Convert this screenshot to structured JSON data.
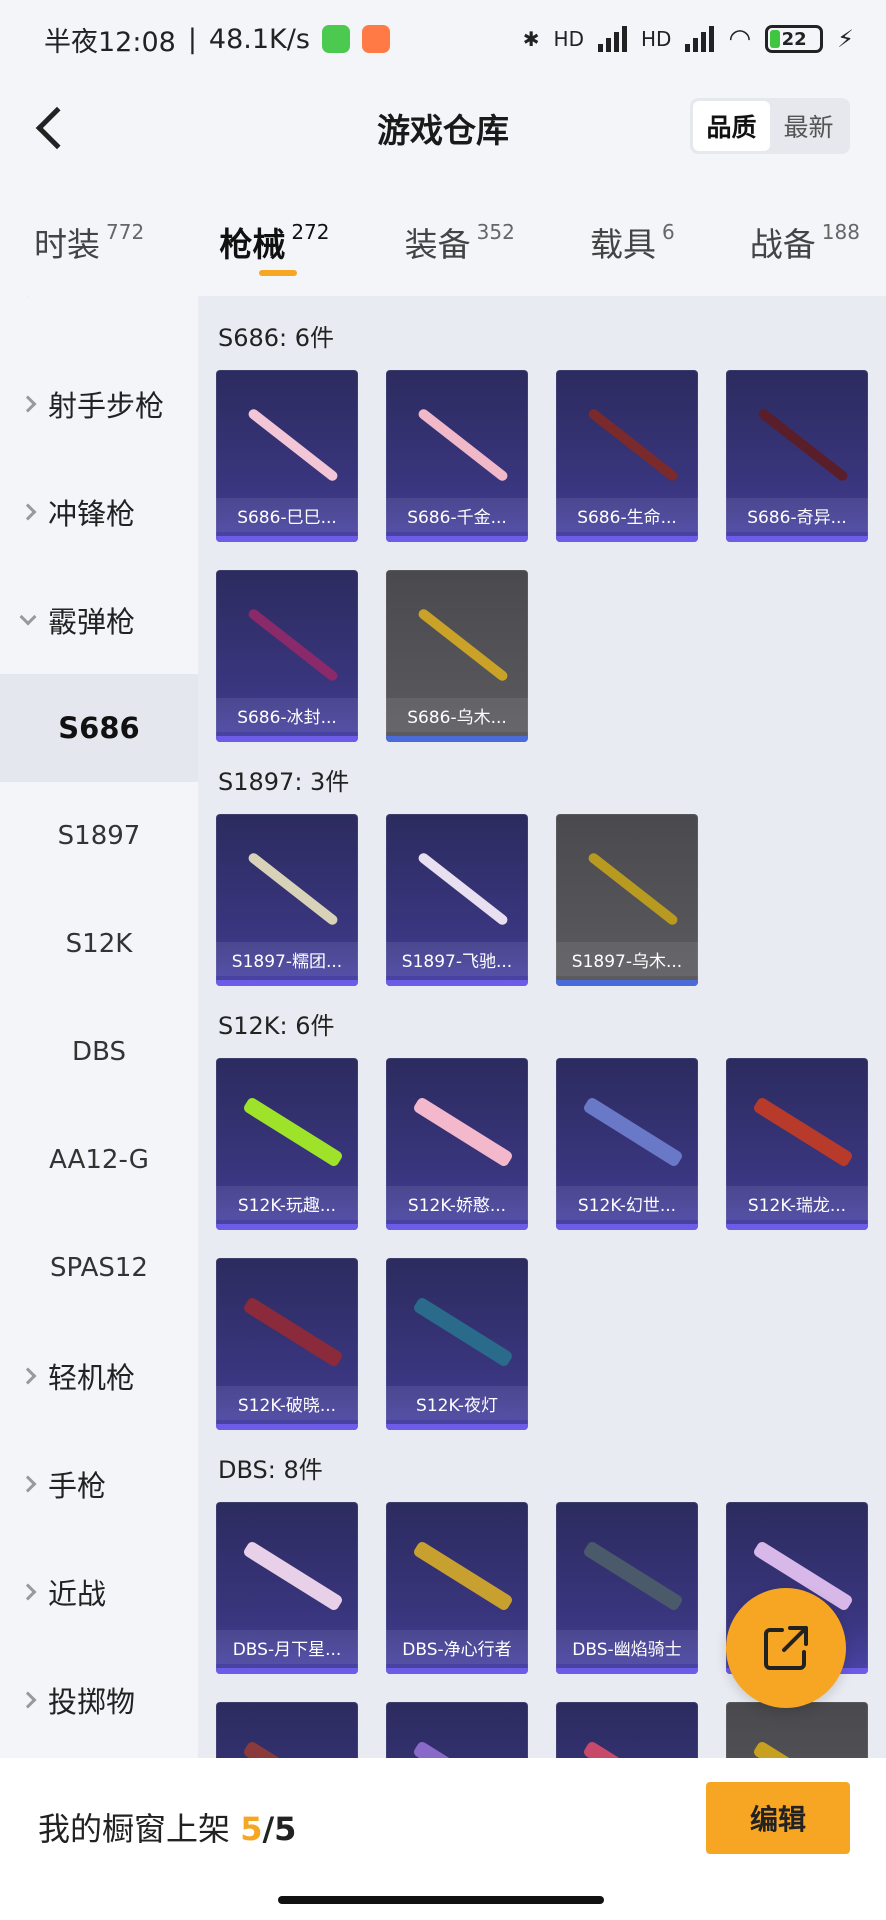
{
  "status_bar": {
    "time": "半夜12:08",
    "speed": "48.1K/s",
    "hd1": "HD",
    "hd2": "HD",
    "battery": "22"
  },
  "header": {
    "title": "游戏仓库",
    "sort_options": [
      "品质",
      "最新"
    ]
  },
  "tabs": [
    {
      "label": "时装",
      "count": "772"
    },
    {
      "label": "枪械",
      "count": "272"
    },
    {
      "label": "装备",
      "count": "352"
    },
    {
      "label": "载具",
      "count": "6"
    },
    {
      "label": "战备",
      "count": "188"
    }
  ],
  "sidebar": {
    "items": [
      {
        "label": "射手步枪"
      },
      {
        "label": "冲锋枪"
      },
      {
        "label": "霰弹枪"
      },
      {
        "label": "S686"
      },
      {
        "label": "S1897"
      },
      {
        "label": "S12K"
      },
      {
        "label": "DBS"
      },
      {
        "label": "AA12-G"
      },
      {
        "label": "SPAS12"
      },
      {
        "label": "轻机枪"
      },
      {
        "label": "手枪"
      },
      {
        "label": "近战"
      },
      {
        "label": "投掷物"
      }
    ]
  },
  "sections": [
    {
      "title": "S686: 6件",
      "items": [
        {
          "name": "S686-巳巳...",
          "gun_color": "#f2c6d6",
          "quality": "purple"
        },
        {
          "name": "S686-千金...",
          "gun_color": "#f0b8c8",
          "quality": "purple"
        },
        {
          "name": "S686-生命...",
          "gun_color": "#7a2a2a",
          "quality": "purple"
        },
        {
          "name": "S686-奇异...",
          "gun_color": "#5a1e2a",
          "quality": "purple"
        },
        {
          "name": "S686-冰封...",
          "gun_color": "#8a2a6a",
          "quality": "purple"
        },
        {
          "name": "S686-乌木...",
          "gun_color": "#c9a227",
          "quality": "grey"
        }
      ]
    },
    {
      "title": "S1897: 3件",
      "items": [
        {
          "name": "S1897-糯团...",
          "gun_color": "#d8d2b8",
          "quality": "purple"
        },
        {
          "name": "S1897-飞驰...",
          "gun_color": "#e8e0f0",
          "quality": "purple"
        },
        {
          "name": "S1897-乌木...",
          "gun_color": "#b89a20",
          "quality": "grey"
        }
      ]
    },
    {
      "title": "S12K: 6件",
      "items": [
        {
          "name": "S12K-玩趣...",
          "gun_color": "#9ee22a",
          "quality": "purple"
        },
        {
          "name": "S12K-娇憨...",
          "gun_color": "#f4b8cc",
          "quality": "purple"
        },
        {
          "name": "S12K-幻世...",
          "gun_color": "#6a78c8",
          "quality": "purple"
        },
        {
          "name": "S12K-瑞龙...",
          "gun_color": "#b83a2a",
          "quality": "purple"
        },
        {
          "name": "S12K-破晓...",
          "gun_color": "#8a2a3a",
          "quality": "purple"
        },
        {
          "name": "S12K-夜灯",
          "gun_color": "#2a6a8a",
          "quality": "purple"
        }
      ]
    },
    {
      "title": "DBS: 8件",
      "items": [
        {
          "name": "DBS-月下星...",
          "gun_color": "#e8d0e8",
          "quality": "purple"
        },
        {
          "name": "DBS-净心行者",
          "gun_color": "#c8a030",
          "quality": "purple"
        },
        {
          "name": "DBS-幽焰骑士",
          "gun_color": "#4a5a6a",
          "quality": "purple"
        },
        {
          "name": "",
          "gun_color": "#d8b8e8",
          "quality": "purple"
        },
        {
          "name": "",
          "gun_color": "#8a3a3a",
          "quality": "purple"
        },
        {
          "name": "",
          "gun_color": "#8a6ac8",
          "quality": "purple"
        },
        {
          "name": "",
          "gun_color": "#c84a6a",
          "quality": "purple"
        },
        {
          "name": "",
          "gun_color": "#c8a020",
          "quality": "grey"
        }
      ]
    }
  ],
  "bottom_bar": {
    "shelf_label": "我的橱窗上架",
    "shelf_used": "5",
    "shelf_total": "/5",
    "edit_label": "编辑"
  },
  "colors": {
    "accent": "#f6a623",
    "card_purple": "#3a3680",
    "card_grey": "#55555a"
  }
}
